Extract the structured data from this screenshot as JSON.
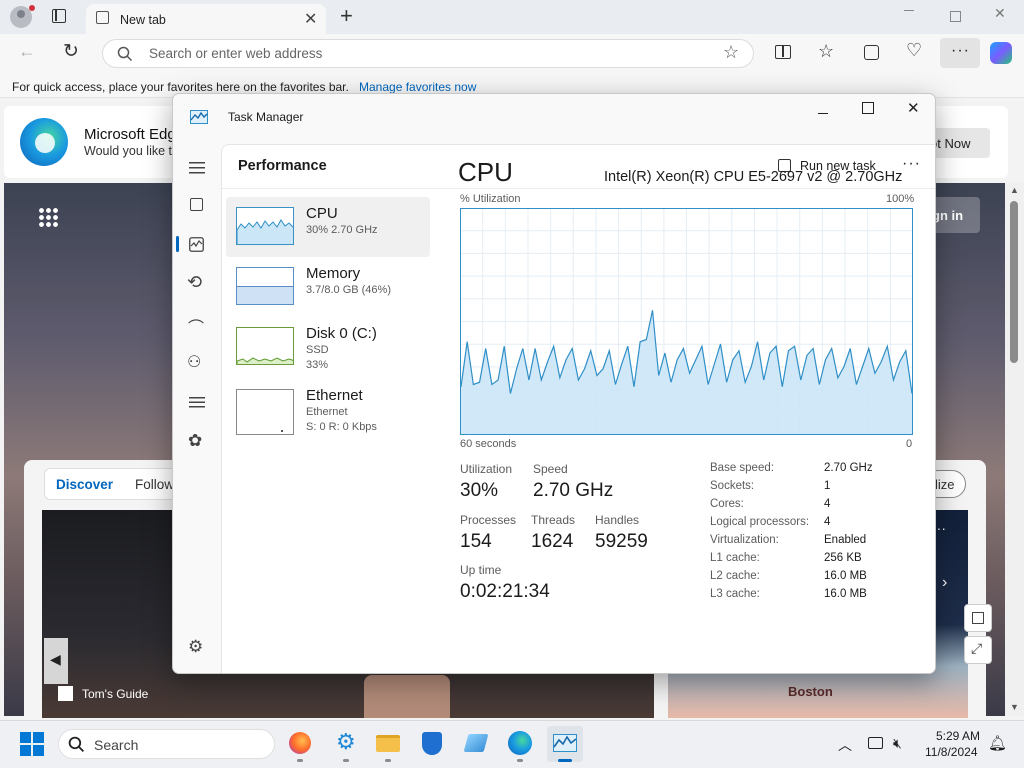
{
  "browser": {
    "tab_title": "New tab",
    "address_placeholder": "Search or enter web address",
    "favorites_hint": "For quick access, place your favorites here on the favorites bar.",
    "favorites_link": "Manage favorites now",
    "banner_title": "Microsoft Edg",
    "banner_sub": "Would you like t",
    "banner_button": "ot Now",
    "sign_in": "gn in",
    "feed_tab_discover": "Discover",
    "feed_tab_following": "Follow",
    "personalize_partial": "lize",
    "card_source": "Tom's Guide",
    "map_label": "Boston",
    "accent": "#0067c0"
  },
  "taskmanager": {
    "window_title": "Task Manager",
    "page_title": "Performance",
    "run_new_task": "Run new task",
    "items": [
      {
        "name": "CPU",
        "sub1": "30%  2.70 GHz",
        "sub2": ""
      },
      {
        "name": "Memory",
        "sub1": "3.7/8.0 GB (46%)",
        "sub2": ""
      },
      {
        "name": "Disk 0 (C:)",
        "sub1": "SSD",
        "sub2": "33%"
      },
      {
        "name": "Ethernet",
        "sub1": "Ethernet",
        "sub2": "S: 0  R: 0 Kbps"
      }
    ],
    "cpu": {
      "heading": "CPU",
      "model": "Intel(R) Xeon(R) CPU E5-2697 v2 @ 2.70GHz",
      "graph_label": "% Utilization",
      "graph_max": "100%",
      "graph_time": "60 seconds",
      "graph_min": "0",
      "utilization_label": "Utilization",
      "utilization": "30%",
      "speed_label": "Speed",
      "speed": "2.70 GHz",
      "processes_label": "Processes",
      "processes": "154",
      "threads_label": "Threads",
      "threads": "1624",
      "handles_label": "Handles",
      "handles": "59259",
      "uptime_label": "Up time",
      "uptime": "0:02:21:34",
      "specs": [
        {
          "k": "Base speed:",
          "v": "2.70 GHz"
        },
        {
          "k": "Sockets:",
          "v": "1"
        },
        {
          "k": "Cores:",
          "v": "4"
        },
        {
          "k": "Logical processors:",
          "v": "4"
        },
        {
          "k": "Virtualization:",
          "v": "Enabled"
        },
        {
          "k": "L1 cache:",
          "v": "256 KB"
        },
        {
          "k": "L2 cache:",
          "v": "16.0 MB"
        },
        {
          "k": "L3 cache:",
          "v": "16.0 MB"
        }
      ],
      "utilization_history": [
        21,
        41,
        22,
        23,
        38,
        22,
        24,
        39,
        18,
        29,
        38,
        24,
        38,
        24,
        32,
        39,
        25,
        33,
        38,
        24,
        29,
        37,
        26,
        29,
        37,
        22,
        31,
        39,
        21,
        41,
        42,
        55,
        26,
        36,
        23,
        33,
        38,
        27,
        33,
        39,
        22,
        31,
        40,
        23,
        33,
        37,
        23,
        30,
        41,
        24,
        36,
        39,
        21,
        37,
        39,
        24,
        35,
        38,
        22,
        33,
        38,
        25,
        30,
        38,
        22,
        30,
        38,
        27,
        32,
        39,
        24,
        32,
        37,
        18
      ],
      "graph_color": "#2f8fc7",
      "graph_fill": "#cbe6f7"
    }
  },
  "taskbar": {
    "search_label": "Search",
    "time": "5:29 AM",
    "date": "11/8/2024"
  }
}
